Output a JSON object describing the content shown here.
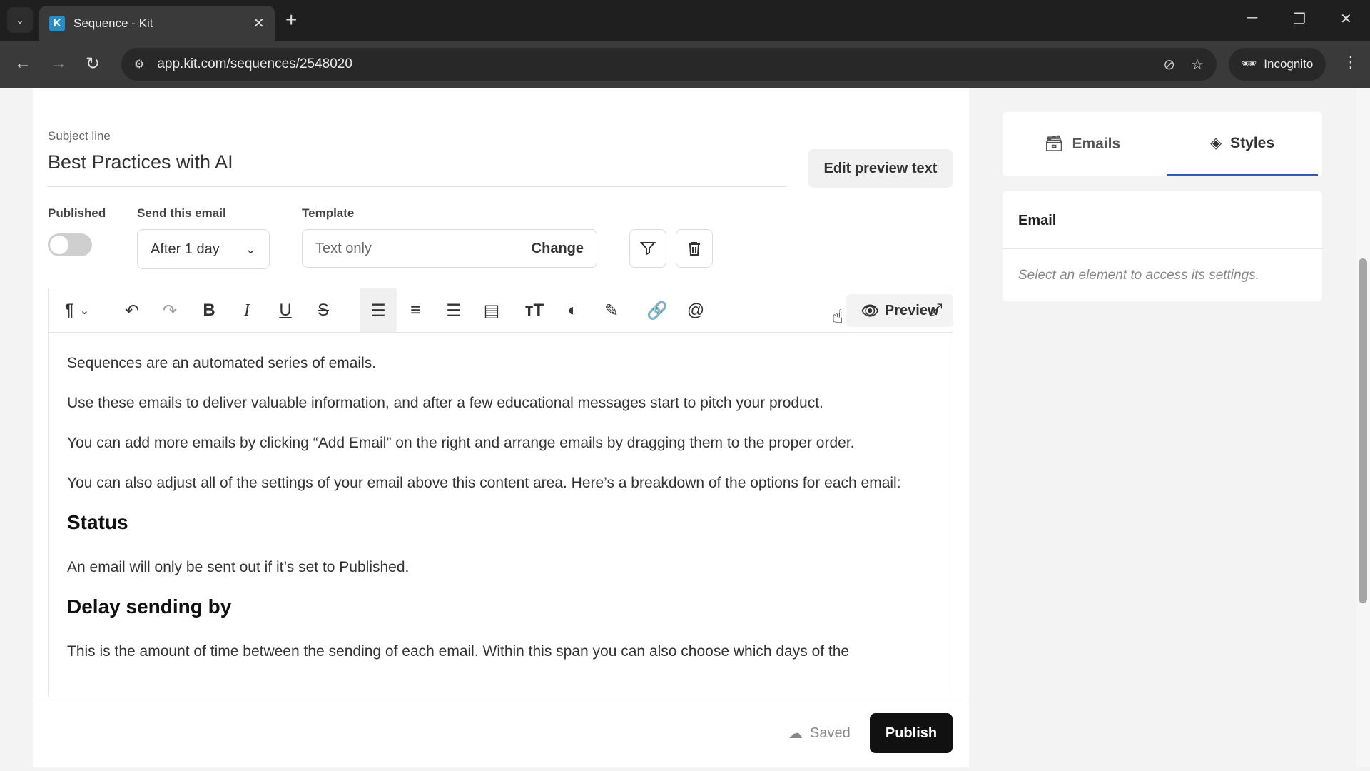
{
  "browser": {
    "tab_title": "Sequence - Kit",
    "favicon_letter": "K",
    "url": "app.kit.com/sequences/2548020",
    "incognito_label": "Incognito"
  },
  "editor": {
    "subject_label": "Subject line",
    "subject_value": "Best Practices with AI",
    "edit_preview_label": "Edit preview text",
    "published_label": "Published",
    "send_label": "Send this email",
    "send_value": "After 1 day",
    "template_label": "Template",
    "template_value": "Text only",
    "template_change": "Change",
    "preview_label": "Preview",
    "content": {
      "p1": "Sequences are an automated series of emails.",
      "p2": "Use these emails to deliver valuable information, and after a few educational messages start to pitch your product.",
      "p3": "You can add more emails by clicking “Add Email” on the right and arrange emails by dragging them to the proper order.",
      "p4": "You can also adjust all of the settings of your email above this content area. Here’s a breakdown of the options for each email:",
      "h1": "Status",
      "p5": "An email will only be sent out if it’s set to Published.",
      "h2": "Delay sending by",
      "p6": "This is the amount of time between the sending of each email. Within this span you can also choose which days of the"
    },
    "saved_label": "Saved",
    "publish_label": "Publish"
  },
  "sidebar": {
    "tab_emails": "Emails",
    "tab_styles": "Styles",
    "card_title": "Email",
    "card_hint": "Select an element to access its settings."
  }
}
